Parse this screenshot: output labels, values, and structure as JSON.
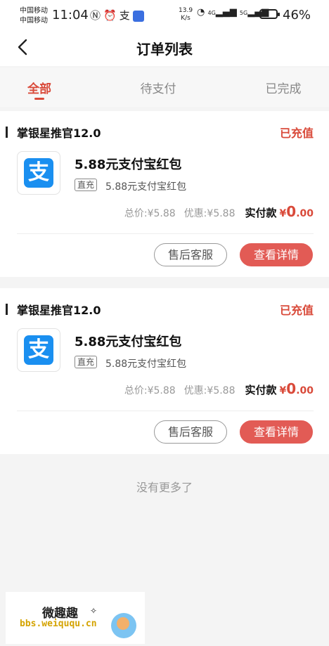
{
  "status_bar": {
    "carrier_1": "中国移动",
    "carrier_2": "中国移动",
    "time": "11:04",
    "net_speed_value": "13.9",
    "net_speed_unit": "K/s",
    "network_1": "4G",
    "network_2": "5G",
    "battery_percent": "46%",
    "battery_level": 0.46
  },
  "header": {
    "title": "订单列表"
  },
  "tabs": [
    {
      "label": "全部",
      "active": true
    },
    {
      "label": "待支付",
      "active": false
    },
    {
      "label": "已完成",
      "active": false
    }
  ],
  "orders": [
    {
      "store": "掌银星推官12.0",
      "status": "已充值",
      "product_name": "5.88元支付宝红包",
      "tag": "直充",
      "sub_name": "5.88元支付宝红包",
      "total_label": "总价:",
      "total": "¥5.88",
      "discount_label": "优惠:",
      "discount": "¥5.88",
      "pay_label": "实付款",
      "pay_currency": "¥",
      "pay_int": "0",
      "pay_dec": ".00",
      "service_button": "售后客服",
      "detail_button": "查看详情"
    },
    {
      "store": "掌银星推官12.0",
      "status": "已充值",
      "product_name": "5.88元支付宝红包",
      "tag": "直充",
      "sub_name": "5.88元支付宝红包",
      "total_label": "总价:",
      "total": "¥5.88",
      "discount_label": "优惠:",
      "discount": "¥5.88",
      "pay_label": "实付款",
      "pay_currency": "¥",
      "pay_int": "0",
      "pay_dec": ".00",
      "service_button": "售后客服",
      "detail_button": "查看详情"
    }
  ],
  "list_end_text": "没有更多了",
  "alipay_logo_char": "支",
  "watermark": {
    "name": "微趣趣",
    "url": "bbs.weiququ.cn"
  },
  "colors": {
    "accent": "#d94a3a",
    "detail_button": "#e25b55",
    "alipay_blue": "#1a8ff0"
  }
}
